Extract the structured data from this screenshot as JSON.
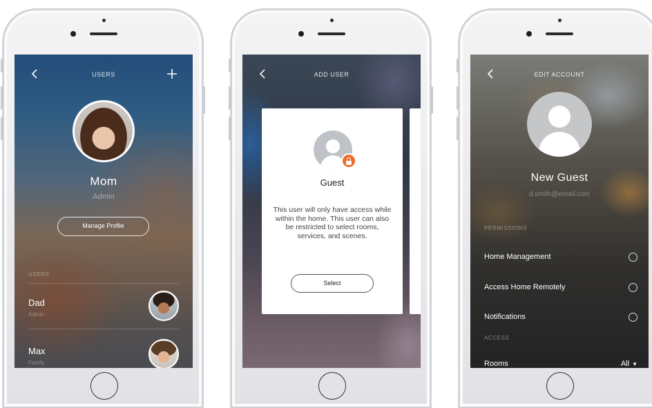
{
  "screen_users": {
    "title": "USERS",
    "profile_name": "Mom",
    "profile_role": "Admin",
    "manage_button": "Manage Profile",
    "section_label": "USERS",
    "users": [
      {
        "name": "Dad",
        "role": "Admin"
      },
      {
        "name": "Max",
        "role": "Family"
      }
    ]
  },
  "screen_add_user": {
    "title": "ADD USER",
    "card_title": "Guest",
    "card_description": "This user will only have access while within the home. This user can also be restricted to select rooms, services, and scenes.",
    "select_button": "Select"
  },
  "screen_edit_account": {
    "title": "EDIT ACCOUNT",
    "name": "New Guest",
    "email": "d.smith@email.com",
    "permissions_label": "PERMISSIONS",
    "permissions": [
      {
        "label": "Home Management"
      },
      {
        "label": "Access Home Remotely"
      },
      {
        "label": "Notifications"
      }
    ],
    "access_label": "ACCESS",
    "rooms_label": "Rooms",
    "rooms_value": "All"
  },
  "colors": {
    "lock_badge": "#ef6a2a",
    "card_background": "#ffffff"
  },
  "icons": [
    "back-chevron-icon",
    "plus-icon",
    "guest-avatar-icon",
    "lock-icon",
    "radio-icon",
    "dropdown-caret-icon"
  ]
}
